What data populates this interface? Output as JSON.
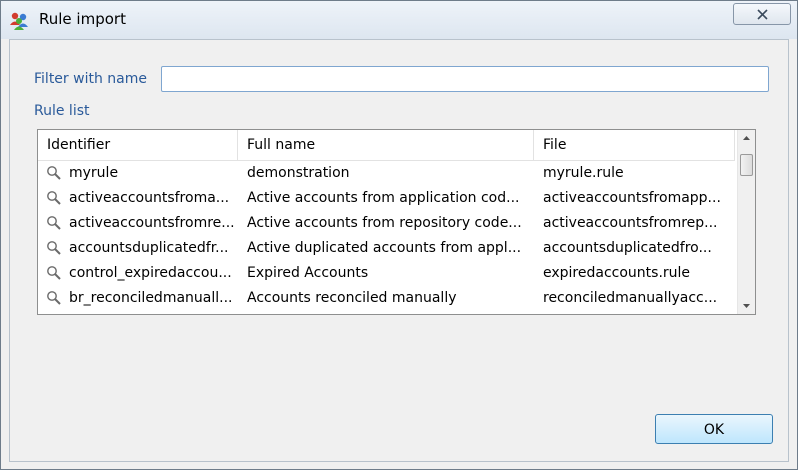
{
  "window": {
    "title": "Rule import"
  },
  "filter": {
    "label": "Filter with name",
    "value": "",
    "placeholder": ""
  },
  "rule_list": {
    "label": "Rule list",
    "columns": [
      "Identifier",
      "Full name",
      "File"
    ],
    "rows": [
      {
        "identifier": "myrule",
        "full_name": "demonstration",
        "file": "myrule.rule"
      },
      {
        "identifier": "activeaccountsfroma...",
        "full_name": "Active accounts from application cod...",
        "file": "activeaccountsfromapp..."
      },
      {
        "identifier": "activeaccountsfromre...",
        "full_name": "Active accounts from repository code...",
        "file": "activeaccountsfromrep..."
      },
      {
        "identifier": "accountsduplicatedfr...",
        "full_name": "Active duplicated accounts from appl...",
        "file": "accountsduplicatedfro..."
      },
      {
        "identifier": "control_expiredaccou...",
        "full_name": "Expired Accounts",
        "file": "expiredaccounts.rule"
      },
      {
        "identifier": "br_reconciledmanuall...",
        "full_name": "Accounts reconciled manually",
        "file": "reconciledmanuallyacc..."
      }
    ]
  },
  "buttons": {
    "ok": "OK"
  },
  "icons": {
    "window_icon": "users-icon",
    "row_icon": "magnifier-icon",
    "close": "close-icon"
  },
  "colors": {
    "label": "#2a5a9a",
    "input_border": "#7fa6d0",
    "ok_border": "#3c7fb1"
  }
}
